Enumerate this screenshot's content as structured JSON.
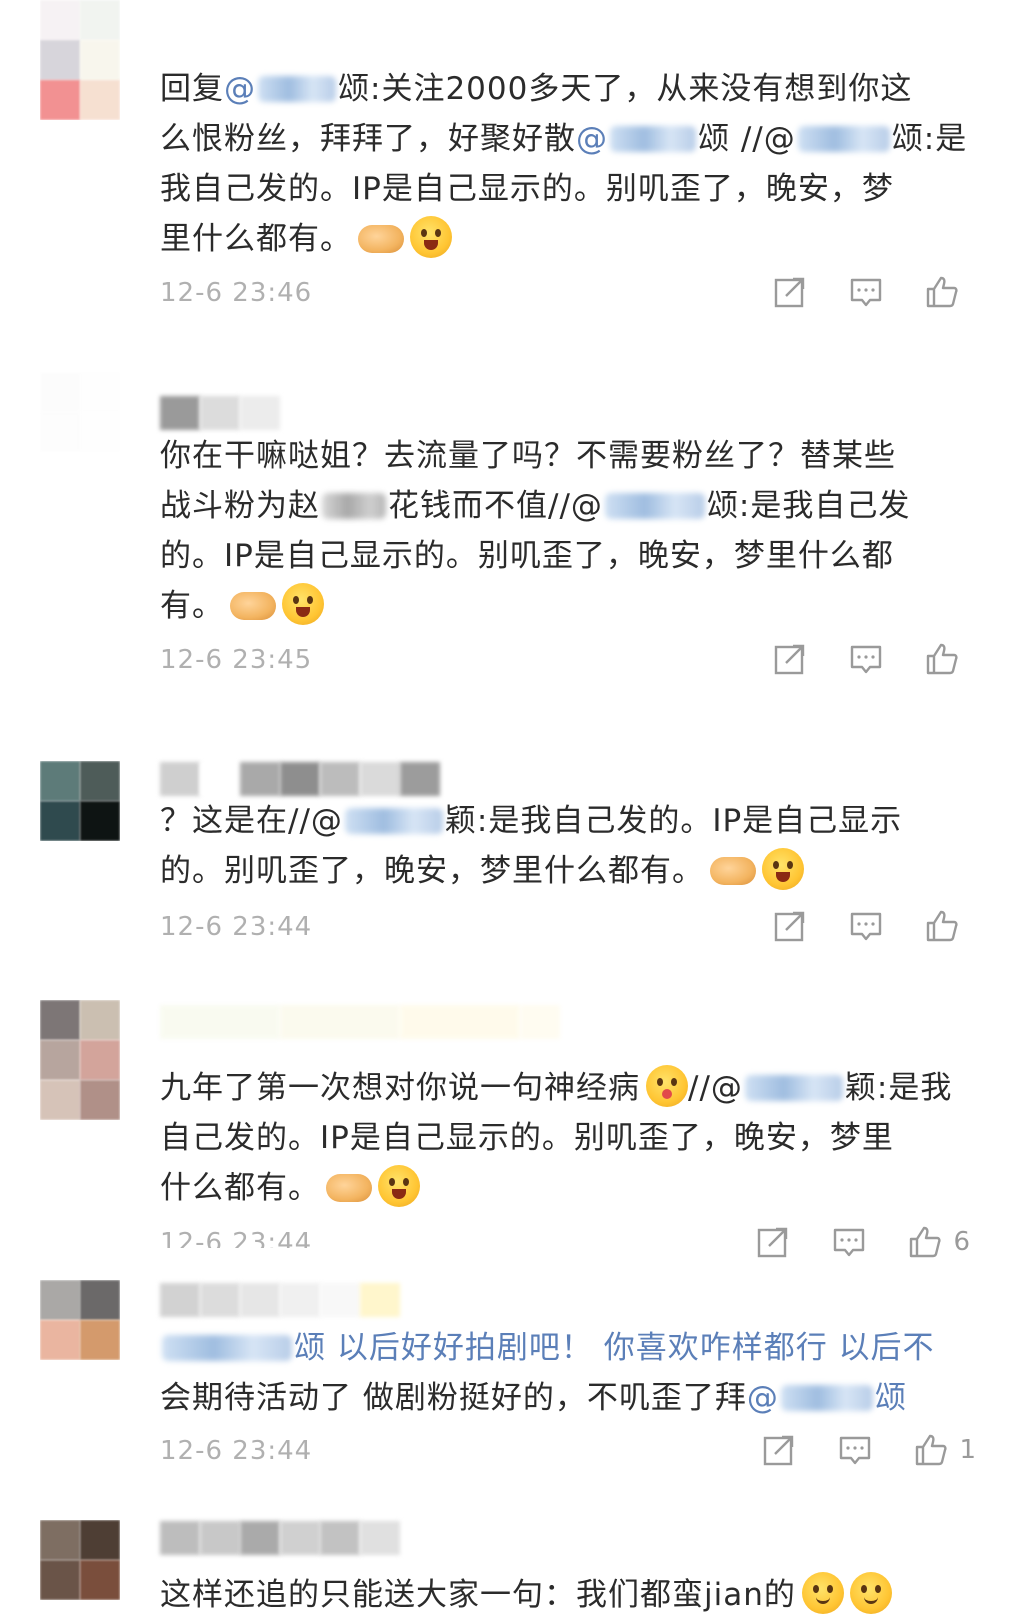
{
  "comments": [
    {
      "body_lines": [
        [
          "回复",
          "@",
          "",
          "颂:关注2000多天了，从来没有想到你这"
        ],
        [
          "么恨粉丝，拜拜了，好聚好散",
          "@",
          "",
          "颂 //@",
          "",
          "颂:是"
        ],
        [
          "我自己发的。IP是自己显示的。别叽歪了，晚安，梦"
        ],
        [
          "里什么都有。"
        ]
      ],
      "time": "12-6 23:46",
      "likes": ""
    },
    {
      "body_lines": [
        [
          "你在干嘛哒姐？去流量了吗？不需要粉丝了？替某些"
        ],
        [
          "战斗粉为赵",
          "",
          "花钱而不值//@",
          "",
          "颂:是我自己发"
        ],
        [
          "的。IP是自己显示的。别叽歪了，晚安，梦里什么都"
        ],
        [
          "有。"
        ]
      ],
      "time": "12-6 23:45",
      "likes": ""
    },
    {
      "body_lines": [
        [
          "？这是在//@",
          "",
          "颖:是我自己发的。IP是自己显示"
        ],
        [
          "的。别叽歪了，晚安，梦里什么都有。"
        ]
      ],
      "time": "12-6 23:44",
      "likes": ""
    },
    {
      "body_lines": [
        [
          "九年了第一次想对你说一句神经病",
          "//@",
          "",
          "颖:是我"
        ],
        [
          "自己发的。IP是自己显示的。别叽歪了，晚安，梦里"
        ],
        [
          "什么都有。"
        ]
      ],
      "time": "12-6 23:44",
      "likes": "6"
    },
    {
      "body_lines": [
        [
          "颂 以后好好拍剧吧！  你喜欢咋样都行  以后不"
        ],
        [
          "会期待活动了  做剧粉挺好的，不叽歪了拜",
          "@",
          "颂"
        ]
      ],
      "time": "12-6 23:44",
      "likes": "1"
    },
    {
      "body_lines": [
        [
          "这样还追的只能送大家一句：我们都蛮jian的"
        ]
      ],
      "time": "",
      "likes": ""
    }
  ],
  "icons": [
    "share-icon",
    "comment-icon",
    "like-icon",
    "handshake-emoji",
    "grin-emoji",
    "kiss-emoji",
    "smile-emoji"
  ],
  "colors": {
    "mention": "#5b7fb8",
    "timestamp": "#b0b0b0",
    "text": "#2b2b2b"
  }
}
